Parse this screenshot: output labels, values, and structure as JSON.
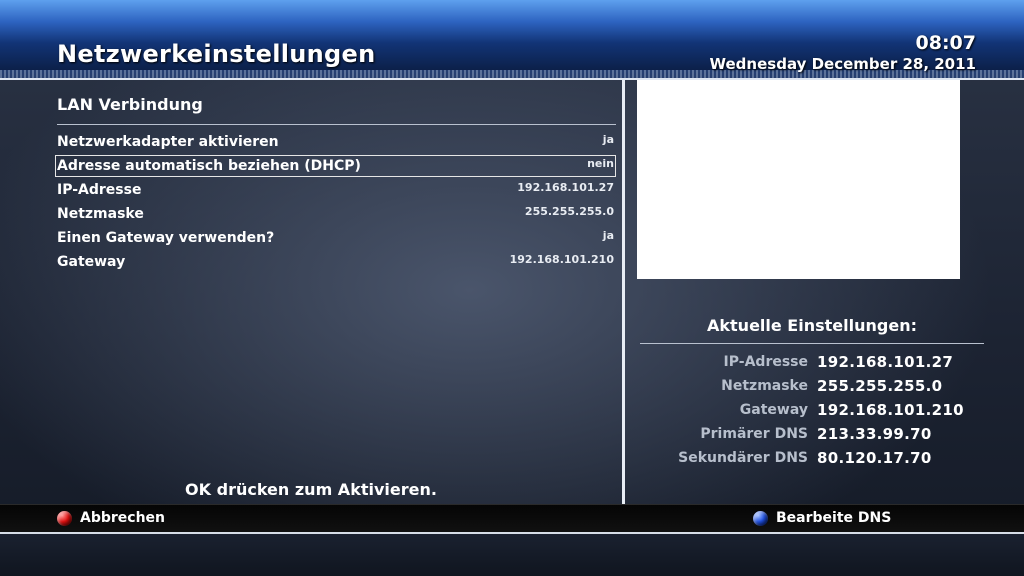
{
  "header": {
    "title": "Netzwerkeinstellungen",
    "time": "08:07",
    "date": "Wednesday December 28, 2011"
  },
  "lan": {
    "section_title": "LAN Verbindung",
    "rows": [
      {
        "label": "Netzwerkadapter aktivieren",
        "value": "ja"
      },
      {
        "label": "Adresse automatisch beziehen (DHCP)",
        "value": "nein",
        "selected": true
      },
      {
        "label": "IP-Adresse",
        "value": "192.168.101.27"
      },
      {
        "label": "Netzmaske",
        "value": "255.255.255.0"
      },
      {
        "label": "Einen Gateway verwenden?",
        "value": "ja"
      },
      {
        "label": "Gateway",
        "value": "192.168.101.210"
      }
    ],
    "hint": "OK drücken zum Aktivieren."
  },
  "current": {
    "title": "Aktuelle Einstellungen:",
    "items": [
      {
        "key": "IP-Adresse",
        "value": "192.168.101.27"
      },
      {
        "key": "Netzmaske",
        "value": "255.255.255.0"
      },
      {
        "key": "Gateway",
        "value": "192.168.101.210"
      },
      {
        "key": "Primärer DNS",
        "value": "213.33.99.70"
      },
      {
        "key": "Sekundärer DNS",
        "value": "80.120.17.70"
      }
    ]
  },
  "footer": {
    "red_button": {
      "label": "Abbrechen",
      "icon": "red-button-icon",
      "color": "#e01010"
    },
    "blue_button": {
      "label": "Bearbeite DNS",
      "icon": "blue-button-icon",
      "color": "#1f4fe0"
    }
  },
  "colors": {
    "header_accent": "#2d63c0",
    "selection_border": "#e6e6e6"
  }
}
